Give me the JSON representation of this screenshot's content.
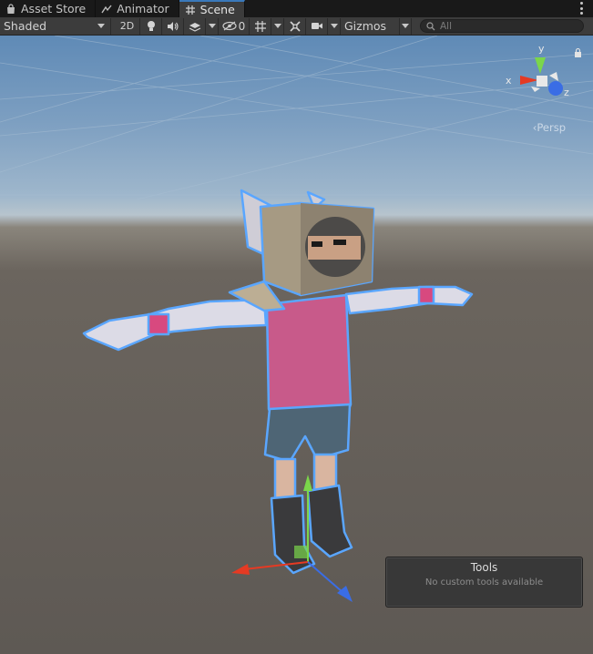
{
  "tabs": [
    {
      "label": "Asset Store",
      "icon": "shopping-bag-icon",
      "active": false
    },
    {
      "label": "Animator",
      "icon": "animator-icon",
      "active": false
    },
    {
      "label": "Scene",
      "icon": "scene-grid-icon",
      "active": true
    }
  ],
  "toolbar": {
    "draw_mode": "Shaded",
    "mode_2d": "2D",
    "hidden_count": "0",
    "gizmos_label": "Gizmos",
    "search_placeholder": "All",
    "icons": [
      "lighting-bulb-icon",
      "audio-icon",
      "effects-icon",
      "scene-visibility-icon",
      "grid-snap-icon",
      "tools-icon",
      "camera-icon",
      "search-icon"
    ]
  },
  "scene": {
    "orientation": {
      "x": "x",
      "y": "y",
      "z": "z",
      "projection": "Persp"
    },
    "colors": {
      "x_axis": "#e53a23",
      "y_axis": "#7bd64a",
      "z_axis": "#3a6de5",
      "selection_outline": "#5aa6ff"
    }
  },
  "tools_overlay": {
    "title": "Tools",
    "subtitle": "No custom tools available"
  }
}
